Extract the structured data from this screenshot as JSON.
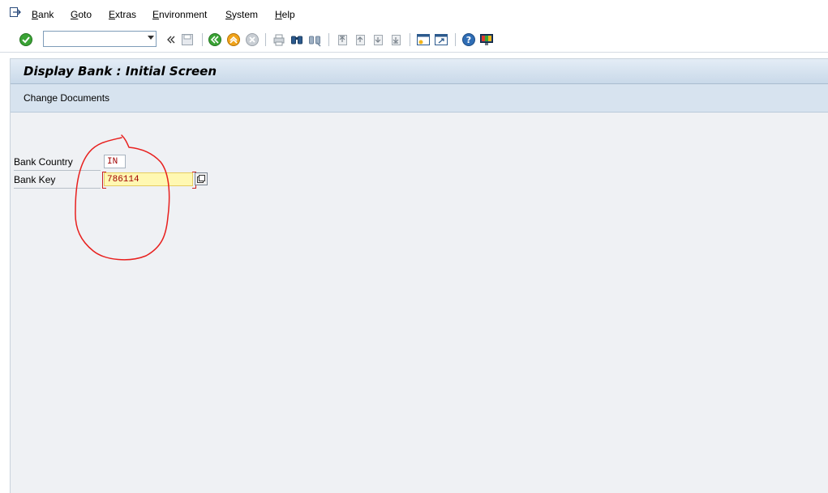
{
  "menubar": {
    "items": [
      "Bank",
      "Goto",
      "Extras",
      "Environment",
      "System",
      "Help"
    ]
  },
  "toolbar": {
    "command_field_value": "",
    "icons": [
      "enter-icon",
      "command-field-dropdown-icon",
      "collapse-icon",
      "save-icon",
      "back-icon",
      "exit-icon",
      "cancel-icon",
      "print-icon",
      "find-icon",
      "find-next-icon",
      "first-page-icon",
      "previous-page-icon",
      "next-page-icon",
      "last-page-icon",
      "create-session-icon",
      "create-shortcut-icon",
      "help-icon",
      "customize-layout-icon"
    ]
  },
  "screen": {
    "title": "Display Bank : Initial Screen",
    "app_toolbar": {
      "change_documents_label": "Change Documents"
    },
    "fields": {
      "bank_country": {
        "label": "Bank Country",
        "value": "IN"
      },
      "bank_key": {
        "label": "Bank Key",
        "value": "786114"
      }
    }
  },
  "annotation": {
    "shape": "red-freehand-circle",
    "color": "#e8201e"
  }
}
